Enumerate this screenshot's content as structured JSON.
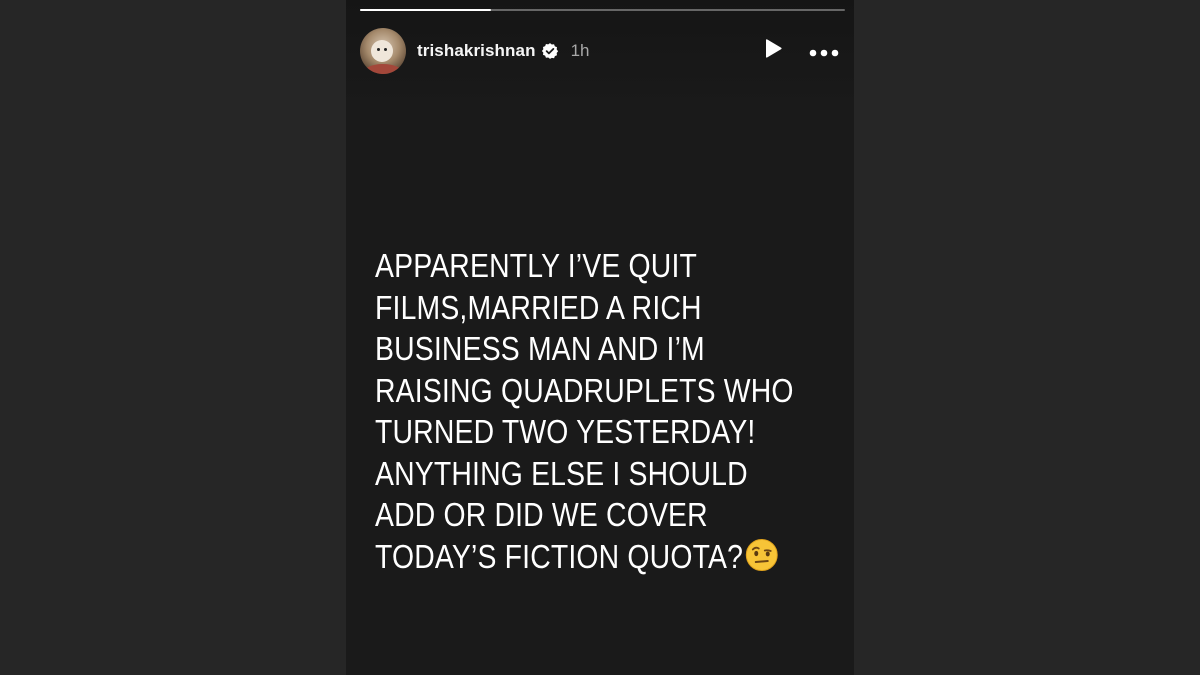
{
  "story": {
    "progress_fraction": 0.27,
    "header": {
      "username": "trishakrishnan",
      "verified": true,
      "timestamp": "1h",
      "avatar_icon": "profile-avatar",
      "play_icon": "play-icon",
      "more_icon": "more-options-icon"
    },
    "text_lines": [
      "APPARENTLY I’VE QUIT",
      "FILMS,MARRIED A RICH",
      "BUSINESS MAN AND I’M",
      "RAISING QUADRUPLETS WHO",
      "TURNED TWO YESTERDAY!",
      "ANYTHING ELSE I SHOULD",
      "ADD OR DID WE COVER",
      "TODAY’S FICTION QUOTA?"
    ],
    "trailing_emoji": "face-with-raised-eyebrow-emoji",
    "colors": {
      "story_background": "#1a1a1a",
      "page_background": "#262626",
      "text": "#ffffff",
      "timestamp": "#a8a8a8"
    }
  }
}
